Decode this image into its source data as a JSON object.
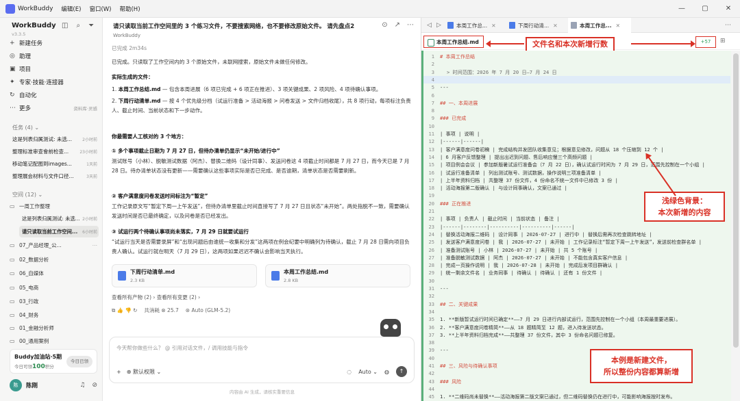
{
  "titlebar": {
    "app_name": "WorkBuddy",
    "menus": [
      "编辑(E)",
      "窗口(W)",
      "帮助(H)"
    ],
    "window_controls": [
      "—",
      "▢",
      "✕"
    ]
  },
  "sidebar": {
    "brand": "WorkBuddy",
    "version": "v3.3.5",
    "nav": [
      {
        "icon": "+",
        "label": "新建任务",
        "extra": ""
      },
      {
        "icon": "◎",
        "label": "助理",
        "extra": ""
      },
      {
        "icon": "▣",
        "label": "项目",
        "extra": ""
      },
      {
        "icon": "✦",
        "label": "专家·技能·连接器",
        "extra": ""
      },
      {
        "icon": "↻",
        "label": "自动化",
        "extra": ""
      },
      {
        "icon": "⋯",
        "label": "更多",
        "extra": "资料库·灵感"
      }
    ],
    "tasks_header": "任务 (4) ⌄",
    "tasks": [
      {
        "title": "这是列表归属测试: 未选...",
        "time": "2小时前"
      },
      {
        "title": "整理标准审查會前检查...",
        "time": "23小时前"
      },
      {
        "title": "移动笔记配图到images...",
        "time": "1天前"
      },
      {
        "title": "整理展会材料与文件口径...",
        "time": "3天前"
      }
    ],
    "spaces_header": "空间 (12) ⌄",
    "space_groups": [
      {
        "label": "一周工作整理",
        "subtasks": [
          {
            "title": "这是列表归属测试: 未选...",
            "time": "2小时前",
            "active": false
          },
          {
            "title": "请只读取当前工作空间...",
            "time": "6小时前",
            "active": true
          }
        ]
      }
    ],
    "spaces": [
      "07_产品经理_公...",
      "02_数据分析",
      "06_自媒体",
      "05_电商",
      "03_行政",
      "04_财务",
      "01_金融分析师",
      "00_通用案例"
    ],
    "buddy": {
      "title": "Buddy加油站·5期",
      "sub_prefix": "今日可领",
      "sub_value": "100",
      "sub_suffix": "积分",
      "button": "今日已领"
    },
    "user": {
      "avatar": "陈",
      "name": "陈刚"
    }
  },
  "chat": {
    "header": "请只读取当前工作空间里的 3 个练习文件，不要搜索网络，也不要修改原始文件。 请先盘点2",
    "agent_name": "WorkBuddy",
    "status": "已完成 2m34s",
    "intro": "已完成。只读取了工作空间内的 3 个原始文件，未联网搜索，原始文件未做任何修改。",
    "files_heading": "实际生成的文件：",
    "file_lines": [
      {
        "prefix": "1.",
        "bold": "本周工作总结.md",
        "rest": " — 包含本周进展（6 项已完成 + 6 项正在推进）、3 项关键成果、2 项风险、4 项待确认事项。"
      },
      {
        "prefix": "2.",
        "bold": "下周行动清单.md",
        "rest": " — 按 4 个优先级分档（试运行准备 > 活动海报 > 问卷发送 > 文件归档收尾），共 8 项行动，每项标注负责人、截止时间、当前状态和下一步动作。"
      }
    ],
    "confirm_heading": "你最需要人工核对的 3 个地方：",
    "confirm_items": [
      {
        "title": "① 多个事项截止日期为 7 月 27 日，但待办清单仍显示“未开始/进行中”",
        "body": "测试账号（小林）、脱敏测试数据（阿杰）、替换二维码（设计同事）、发送问卷这 4 项截止时间都是 7 月 27 日，而今天已是 7 月 28 日。待办清单状态没有更新——需要确认这些事项实际是否已完成、是否逾期，清单状态是否需要刷新。"
      },
      {
        "title": "② 客户满意度问卷发送时间标注为“暂定”",
        "body": "工作记录原文写“暂定下周一上午发送”，但待办清单里截止时间直接写了 7 月 27 日且状态“未开始”。两处指脱不一致，需要确认发送时间是否已最终确定，以及问卷是否已经发出。"
      },
      {
        "title": "③ 试运行两个待确认事项尚未落实，7 月 29 日就要试运行",
        "body": "“试运行当天是否需要录屏”和“出现问题后由谁统一收集和分发”这两项在例会纪要中明确列为待确认，截止 7 月 28 日需向项目负责人确认。试运行就在明天（7 月 29 日），这两项如果迟迟不确认会影响当天执行。"
      }
    ],
    "cards": [
      {
        "name": "下周行动清单.md",
        "size": "2.3 KB"
      },
      {
        "name": "本周工作总结.md",
        "size": "2.8 KB"
      }
    ],
    "links": "查看所有产物 (2) ›    查看所有变更 (2) ›",
    "meta": {
      "icons": "⧉  👍  👎  ↻",
      "consume_label": "共消耗",
      "consume_value": "25.7",
      "model": "Auto (GLM-5.2)"
    },
    "input_placeholder": "今天帮你做些什么？ @ 引用对话文件，/ 调用技能与指令",
    "input_left": {
      "plus": "+",
      "permission": "默认权限 ⌄"
    },
    "input_right": {
      "mode": "Auto ⌄",
      "send": "↑"
    },
    "disclaimer": "内容由 AI 生成，请核实重要信息"
  },
  "viewer": {
    "tabs": [
      {
        "label": "本周工作总...",
        "active": false
      },
      {
        "label": "下周行动清...",
        "active": false
      },
      {
        "label": "本周工作总...",
        "active": true
      }
    ],
    "file_name": "本周工作总结.md",
    "added_count": "+57",
    "callout_top": "文件名和本次新增行数",
    "callout_green": [
      "浅绿色背景：",
      "本次新增的内容"
    ],
    "callout_new": [
      "本例是新建文件，",
      "所以整份内容都算新增"
    ],
    "lines": [
      {
        "no": "1",
        "text": "# 本周工作总结",
        "type": "hd"
      },
      {
        "no": "2",
        "text": "",
        "type": ""
      },
      {
        "no": "3",
        "text": "> 时间范围：2026 年 7 月 20 日—7 月 24 日",
        "type": "meta"
      },
      {
        "no": "4",
        "text": "",
        "type": "hl"
      },
      {
        "no": "5",
        "text": "---",
        "type": ""
      },
      {
        "no": "6",
        "text": "",
        "type": ""
      },
      {
        "no": "7",
        "text": "## 一、本周进展",
        "type": "hd"
      },
      {
        "no": "8",
        "text": "",
        "type": ""
      },
      {
        "no": "9",
        "text": "### 已完成",
        "type": "hd"
      },
      {
        "no": "10",
        "text": "",
        "type": ""
      },
      {
        "no": "11",
        "text": "| 事项 | 说明 |",
        "type": ""
      },
      {
        "no": "12",
        "text": "|------|------|",
        "type": ""
      },
      {
        "no": "13",
        "text": "| 客户满意度问卷初稿 | 完成结构并发团队收集意见；根据意见修改，问题从 18 个压缩到 12 个 |",
        "type": ""
      },
      {
        "no": "14",
        "text": "| 6 月客户反馈整理 | 提出出迟到问题、售后响应慢三个高频问题 |",
        "type": ""
      },
      {
        "no": "15",
        "text": "| 项目例会会议 | 参加新版暑试运行准备会（7 月 22 日），确认试运行时间为 7 月 29 日，范围先控制在一个小组 |",
        "type": ""
      },
      {
        "no": "16",
        "text": "| 试运行准备清单 | 列出测试账号、测试数据，操作说明三项准备清单 |",
        "type": ""
      },
      {
        "no": "17",
        "text": "| 上半年资料归档 | 共整理 37 份文件，4 份命名不统一文件中已修改 3 份 |",
        "type": ""
      },
      {
        "no": "18",
        "text": "| 活动海报第二版确认 | 与设计同事确认，文案已通过 |",
        "type": ""
      },
      {
        "no": "19",
        "text": "",
        "type": ""
      },
      {
        "no": "20",
        "text": "### 正在推进",
        "type": "hd"
      },
      {
        "no": "21",
        "text": "",
        "type": ""
      },
      {
        "no": "22",
        "text": "| 事项 | 负责人 | 截止时间 | 当前状态 | 备注 |",
        "type": ""
      },
      {
        "no": "23",
        "text": "|------|--------|----------|----------|------|",
        "type": ""
      },
      {
        "no": "24",
        "text": "| 替换活动海报二维码 | 设计同事 | 2026-07-27 | 进行中 | 替换后需再次检查跳转地址 |",
        "type": ""
      },
      {
        "no": "25",
        "text": "| 发送客户满意度问卷 | 我 | 2026-07-27 | 未开始 | 工作记录标注“暂定下周一上午发送”，发送前检查群名单 |",
        "type": ""
      },
      {
        "no": "26",
        "text": "| 准备测试账号 | 小林 | 2026-07-27 | 未开始 | 共 5 个账号 |",
        "type": ""
      },
      {
        "no": "27",
        "text": "| 准备脱敏测试数据 | 阿杰 | 2026-07-27 | 未开始 | 不能包含真实客户信息 |",
        "type": ""
      },
      {
        "no": "28",
        "text": "| 完成一页操作说明 | 我 | 2026-07-28 | 未开始 | 完成后发项目群确认 |",
        "type": ""
      },
      {
        "no": "29",
        "text": "| 统一剩余文件名 | 业务同事 | 待确认 | 待确认 | 还有 1 份文件 |",
        "type": ""
      },
      {
        "no": "30",
        "text": "",
        "type": ""
      },
      {
        "no": "31",
        "text": "---",
        "type": ""
      },
      {
        "no": "32",
        "text": "",
        "type": ""
      },
      {
        "no": "33",
        "text": "## 二、关键成果",
        "type": "hd"
      },
      {
        "no": "34",
        "text": "",
        "type": ""
      },
      {
        "no": "35",
        "text": "1. **新版暂试运行时间已确定**——7 月 29 日进行内部试运行，范围先控制在一个小组（本周最重要进展）。",
        "type": "li"
      },
      {
        "no": "36",
        "text": "2. **客户满意度问卷精简**——从 18 题精简至 12 题，进入待发送状态。",
        "type": "li"
      },
      {
        "no": "37",
        "text": "3. **上半年资料归档完成**——共整理 37 份文件，其中 3 份命名问题已修复。",
        "type": "li"
      },
      {
        "no": "38",
        "text": "",
        "type": ""
      },
      {
        "no": "39",
        "text": "---",
        "type": ""
      },
      {
        "no": "40",
        "text": "",
        "type": ""
      },
      {
        "no": "41",
        "text": "## 三、风险与待确认事项",
        "type": "hd"
      },
      {
        "no": "42",
        "text": "",
        "type": ""
      },
      {
        "no": "43",
        "text": "### 风险",
        "type": "hd"
      },
      {
        "no": "44",
        "text": "",
        "type": ""
      },
      {
        "no": "45",
        "text": "1. **二维码尚未替换**——活动海报第二版文案已通过，但二维码替换仍在进行中，可能影响海报按时发布。",
        "type": "li"
      }
    ]
  }
}
